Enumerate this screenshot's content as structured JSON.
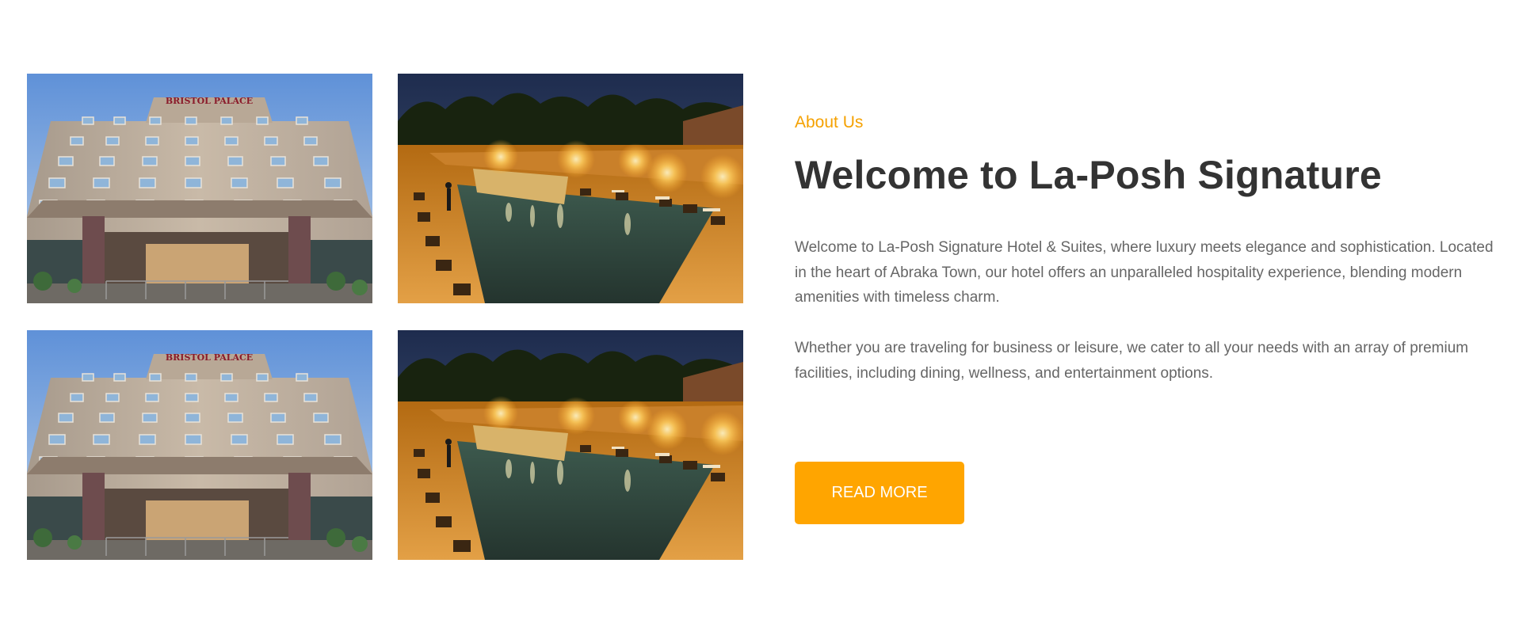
{
  "gallery": {
    "images": [
      {
        "scene": "hotel-facade",
        "sign_text": "BRISTOL PALACE"
      },
      {
        "scene": "poolside-night"
      },
      {
        "scene": "hotel-facade",
        "sign_text": "BRISTOL PALACE"
      },
      {
        "scene": "poolside-night"
      }
    ]
  },
  "about": {
    "eyebrow": "About Us",
    "title": "Welcome to La-Posh Signature",
    "paragraph1": "Welcome to La-Posh Signature Hotel & Suites, where luxury meets elegance and sophistication. Located in the heart of Abraka Town, our hotel offers an unparalleled hospitality experience, blending modern amenities with timeless charm.",
    "paragraph2": "Whether you are traveling for business or leisure, we cater to all your needs with an array of premium facilities, including dining, wellness, and entertainment options.",
    "button_label": "READ MORE"
  },
  "colors": {
    "accent": "#ffa500",
    "heading": "#333333",
    "body_text": "#666666"
  }
}
